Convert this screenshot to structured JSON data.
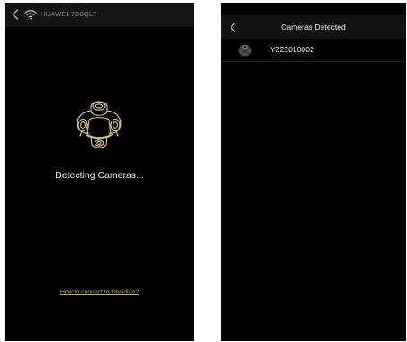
{
  "left_screen": {
    "header": {
      "back_icon": "chevron-left-icon",
      "wifi_icon": "wifi-icon",
      "network_name": "HUAWEI-7D8QLT"
    },
    "illustration_icon": "camera-outline-icon",
    "status_text": "Detecting Cameras...",
    "help_link": "How to connect to Obsidian?"
  },
  "right_screen": {
    "header": {
      "back_icon": "chevron-left-icon",
      "title": "Cameras Detected"
    },
    "cameras": [
      {
        "thumbnail_icon": "camera-thumbnail-icon",
        "serial": "Y222010002"
      }
    ]
  },
  "colors": {
    "background": "#000000",
    "header": "#141414",
    "text": "#ececec",
    "muted_text": "#8a8a8a",
    "link": "#c9b26a"
  }
}
